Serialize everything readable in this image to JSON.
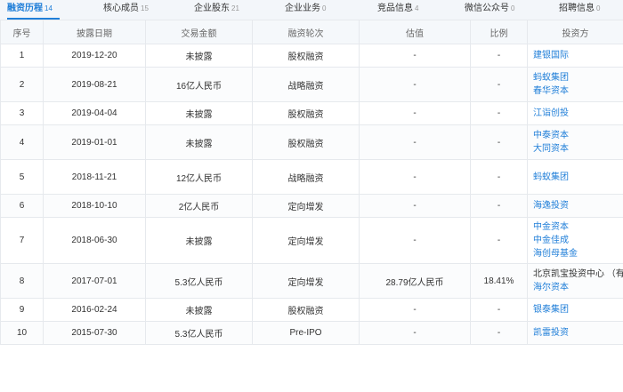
{
  "tabs": [
    {
      "label": "融资历程",
      "count": "14",
      "active": true
    },
    {
      "label": "核心成员",
      "count": "15"
    },
    {
      "label": "企业股东",
      "count": "21"
    },
    {
      "label": "企业业务",
      "count": "0"
    },
    {
      "label": "竞品信息",
      "count": "4"
    },
    {
      "label": "微信公众号",
      "count": "0"
    },
    {
      "label": "招聘信息",
      "count": "0"
    }
  ],
  "headers": [
    "序号",
    "披露日期",
    "交易金额",
    "融资轮次",
    "估值",
    "比例",
    "投资方"
  ],
  "rows": [
    {
      "no": "1",
      "date": "2019-12-20",
      "amount": "未披露",
      "round": "股权融资",
      "valuation": "-",
      "ratio": "-",
      "investors": [
        "建银国际"
      ]
    },
    {
      "no": "2",
      "date": "2019-08-21",
      "amount": "16亿人民币",
      "round": "战略融资",
      "valuation": "-",
      "ratio": "-",
      "investors": [
        "蚂蚁集团",
        "春华资本"
      ]
    },
    {
      "no": "3",
      "date": "2019-04-04",
      "amount": "未披露",
      "round": "股权融资",
      "valuation": "-",
      "ratio": "-",
      "investors": [
        "江诣创投"
      ]
    },
    {
      "no": "4",
      "date": "2019-01-01",
      "amount": "未披露",
      "round": "股权融资",
      "valuation": "-",
      "ratio": "-",
      "investors": [
        "中泰资本",
        "大同资本"
      ]
    },
    {
      "no": "5",
      "date": "2018-11-21",
      "amount": "12亿人民币",
      "round": "战略融资",
      "valuation": "-",
      "ratio": "-",
      "investors": [
        "蚂蚁集团"
      ]
    },
    {
      "no": "6",
      "date": "2018-10-10",
      "amount": "2亿人民币",
      "round": "定向增发",
      "valuation": "-",
      "ratio": "-",
      "investors": [
        "海逸投资"
      ]
    },
    {
      "no": "7",
      "date": "2018-06-30",
      "amount": "未披露",
      "round": "定向增发",
      "valuation": "-",
      "ratio": "-",
      "investors": [
        "中金资本",
        "中金佳成",
        "海创母基金"
      ]
    },
    {
      "no": "8",
      "date": "2017-07-01",
      "amount": "5.3亿人民币",
      "round": "定向增发",
      "valuation": "28.79亿人民币",
      "ratio": "18.41%",
      "investors": [
        "北京凯宝投资中心 （有限合伙",
        "海尔资本"
      ]
    },
    {
      "no": "9",
      "date": "2016-02-24",
      "amount": "未披露",
      "round": "股权融资",
      "valuation": "-",
      "ratio": "-",
      "investors": [
        "银泰集团"
      ]
    },
    {
      "no": "10",
      "date": "2015-07-30",
      "amount": "5.3亿人民币",
      "round": "Pre-IPO",
      "valuation": "-",
      "ratio": "-",
      "investors": [
        "凯雷投资"
      ]
    }
  ]
}
